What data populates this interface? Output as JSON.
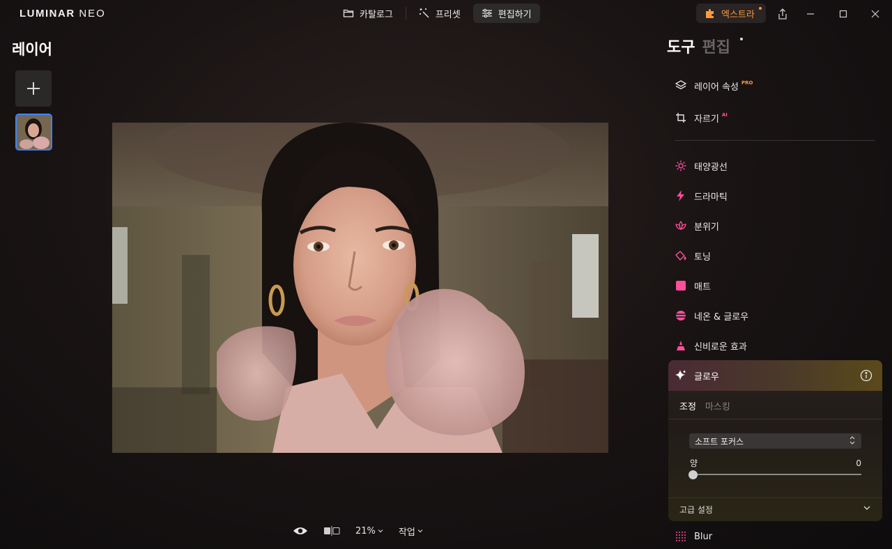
{
  "app": {
    "logo_main": "LUMINAR",
    "logo_sub": "NEO"
  },
  "topnav": {
    "catalog": "카탈로그",
    "presets": "프리셋",
    "edit": "편집하기",
    "extras": "엑스트라"
  },
  "layers": {
    "title": "레이어"
  },
  "bottom": {
    "zoom": "21%",
    "actions": "작업"
  },
  "right": {
    "tab_tools": "도구",
    "tab_edit": "편집",
    "tools": [
      {
        "label": "레이어 속성",
        "badge": "PRO",
        "icon": "layers-icon"
      },
      {
        "label": "자르기",
        "badge": "AI",
        "icon": "crop-icon"
      },
      {
        "label": "태양광선",
        "icon": "sun-icon"
      },
      {
        "label": "드라마틱",
        "icon": "lightning-icon"
      },
      {
        "label": "분위기",
        "icon": "lotus-icon"
      },
      {
        "label": "토닝",
        "icon": "paint-bucket-icon"
      },
      {
        "label": "매트",
        "icon": "square-icon"
      },
      {
        "label": "네온 & 글로우",
        "icon": "neon-icon"
      },
      {
        "label": "신비로운 효과",
        "icon": "mystic-icon"
      },
      {
        "label": "Blur",
        "icon": "blur-icon"
      }
    ],
    "glow": {
      "title": "글로우",
      "tab_adjust": "조정",
      "tab_masking": "마스킹",
      "mode": "소프트 포커스",
      "amount_label": "양",
      "amount_value": "0",
      "advanced": "고급 설정"
    }
  },
  "colors": {
    "accent_pink": "#ff4f9a",
    "accent_orange": "#ff9a3c",
    "selection_blue": "#3a86ff"
  }
}
